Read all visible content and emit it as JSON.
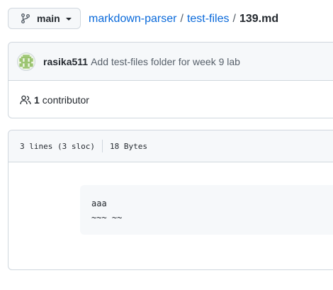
{
  "branch": {
    "icon": "git-branch-icon",
    "label": "main"
  },
  "breadcrumb": {
    "repo": "markdown-parser",
    "folder": "test-files",
    "file": "139.md",
    "separator": "/"
  },
  "commit": {
    "avatar_icon": "identicon-avatar",
    "author": "rasika511",
    "message": "Add test-files folder for week 9 lab"
  },
  "contributors": {
    "icon": "people-icon",
    "count": "1",
    "label": "contributor"
  },
  "file_info": {
    "lines": "3 lines (3 sloc)",
    "size": "18 Bytes"
  },
  "code": {
    "lines": [
      "aaa",
      "~~~ ~~"
    ]
  },
  "colors": {
    "link": "#0969da",
    "border": "#d0d7de",
    "header_bg": "#f6f8fa",
    "avatar_green": "#9bc470"
  }
}
